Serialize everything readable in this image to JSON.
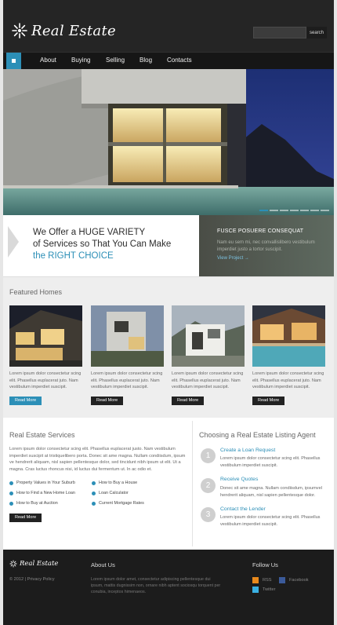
{
  "header": {
    "logo_text": "Real Estate",
    "search_placeholder": "",
    "search_button": "search"
  },
  "nav": {
    "items": [
      "About",
      "Buying",
      "Selling",
      "Blog",
      "Contacts"
    ]
  },
  "offer": {
    "line1": "We Offer a HUGE VARIETY",
    "line2": "of Services so That You Can Make",
    "line3": "the RIGHT CHOICE"
  },
  "promo": {
    "title": "FUSCE POSUERE CONSEQUAT",
    "text": "Nam eu sem mi, nec convallislibero vestibulum imperdiet justo a tortor suscipit.",
    "link": "View Project →"
  },
  "featured": {
    "title": "Featured Homes",
    "cards": [
      {
        "text": "Lorem ipsum dolor consectetur scing elit. Phasellus euplacerat juto. Nam vestibulum imperdiet suscipit.",
        "button": "Read More"
      },
      {
        "text": "Lorem ipsum dolor consectetur scing elit. Phasellus euplacerat juto. Nam vestibulum imperdiet suscipit.",
        "button": "Read More"
      },
      {
        "text": "Lorem ipsum dolor consectetur scing elit. Phasellus euplacerat juto. Nam vestibulum imperdiet suscipit.",
        "button": "Read More"
      },
      {
        "text": "Lorem ipsum dolor consectetur scing elit. Phasellus euplacerat juto. Nam vestibulum imperdiet suscipit.",
        "button": "Read More"
      }
    ]
  },
  "services": {
    "title": "Real Estate Services",
    "text": "Lorem ipsum dolor consectetur scing elit. Phasellus euplacerat justo. Nam vestibulum imperdiet suscipit at tristiquelibero porta. Donec sit ame magna. Nullam condiisdum, ipsum ve hendrerit aliquam, nisl sapien pellentesque dolor, sed tincidunt nibh ipsum ut elit. Ut a magna. Cras luctus rhoncus nisi, id luctus dui fermentum ut. In ac odio et.",
    "links": [
      "Property Values in Your Suburb",
      "How to Find a New Home Loan",
      "How to Buy at Auction",
      "How to Buy a House",
      "Loan Calculator",
      "Current Mortgage Rates"
    ],
    "button": "Read More"
  },
  "agent": {
    "title": "Choosing a Real Estate Listing Agent",
    "steps": [
      {
        "num": "1",
        "title": "Create a Loan Request",
        "text": "Lorem ipsum dolor consectetur scing elit. Phasellus vestibulum imperdiet suscipit."
      },
      {
        "num": "2",
        "title": "Receive Quotes",
        "text": "Donec sit ame magna. Nullam condiisdum, ipsumvel hendrerit aliquam, nisl sapien pellentesque dolor."
      },
      {
        "num": "3",
        "title": "Contact the Lender",
        "text": "Lorem ipsum dolor consectetur scing elit. Phasellus vestibulum imperdiet suscipit."
      }
    ]
  },
  "footer": {
    "logo_text": "Real Estate",
    "copyright": "© 2012   |   Privacy Policy",
    "about_title": "About Us",
    "about_text": "Lorem ipsum dolor amet, consectetur adipiscing pellentesque dui ipsum, mattis dugnissim non, ornare nibh aptent sociosqu torquent per conubia, inceptos himenaeos.",
    "follow_title": "Follow Us",
    "social": [
      "RSS",
      "Facebook",
      "Twitter"
    ]
  },
  "colors": {
    "accent": "#2c8fb7",
    "header_bg": "#252525",
    "footer_bg": "#1c1c1c"
  },
  "hero": {
    "slide_count": 7,
    "active_slide": 1
  }
}
